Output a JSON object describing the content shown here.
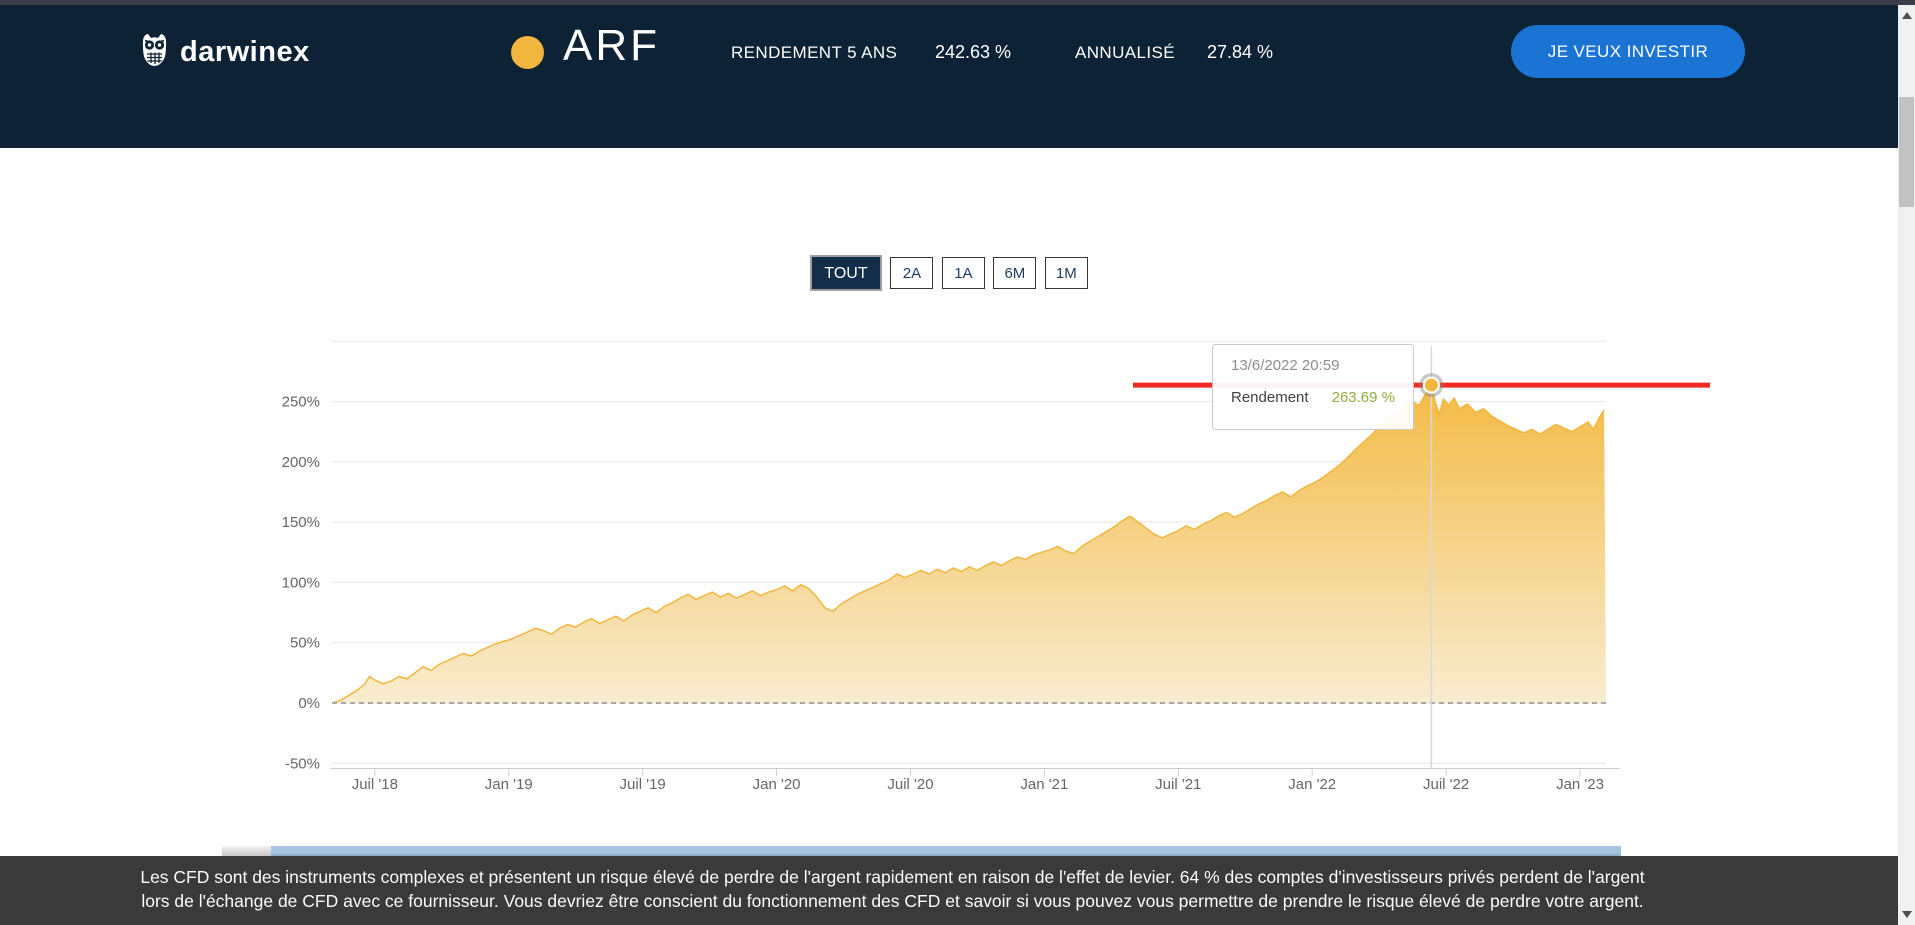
{
  "header": {
    "brand": "darwinex",
    "asset_symbol": "ARF",
    "asset_dot_color": "#f0b63d",
    "bg_color": "#0d2335",
    "stats": [
      {
        "label": "RENDEMENT 5 ANS",
        "value": "242.63 %"
      },
      {
        "label": "ANNUALISÉ",
        "value": "27.84 %"
      }
    ],
    "cta_label": "JE VEUX INVESTIR",
    "cta_color": "#1b74d3"
  },
  "range_selector": {
    "selected": "TOUT",
    "buttons": [
      "TOUT",
      "2A",
      "1A",
      "6M",
      "1M"
    ]
  },
  "chart_data": {
    "type": "area",
    "title": "",
    "series": [
      {
        "name": "Rendement",
        "color": "#f0b63d",
        "fill_top": "#f3bb45",
        "fill_bottom": "#f8ecd0",
        "points": [
          [
            2018.34,
            0
          ],
          [
            2018.37,
            2
          ],
          [
            2018.4,
            6
          ],
          [
            2018.43,
            10
          ],
          [
            2018.46,
            15
          ],
          [
            2018.48,
            22
          ],
          [
            2018.5,
            19
          ],
          [
            2018.53,
            16
          ],
          [
            2018.56,
            18
          ],
          [
            2018.59,
            22
          ],
          [
            2018.62,
            20
          ],
          [
            2018.65,
            25
          ],
          [
            2018.68,
            30
          ],
          [
            2018.71,
            27
          ],
          [
            2018.74,
            32
          ],
          [
            2018.77,
            35
          ],
          [
            2018.8,
            38
          ],
          [
            2018.83,
            41
          ],
          [
            2018.86,
            39
          ],
          [
            2018.89,
            43
          ],
          [
            2018.92,
            46
          ],
          [
            2018.95,
            49
          ],
          [
            2018.98,
            51
          ],
          [
            2019.01,
            53
          ],
          [
            2019.04,
            56
          ],
          [
            2019.07,
            59
          ],
          [
            2019.1,
            62
          ],
          [
            2019.13,
            60
          ],
          [
            2019.16,
            57
          ],
          [
            2019.19,
            62
          ],
          [
            2019.22,
            65
          ],
          [
            2019.25,
            63
          ],
          [
            2019.28,
            67
          ],
          [
            2019.31,
            70
          ],
          [
            2019.34,
            66
          ],
          [
            2019.37,
            69
          ],
          [
            2019.4,
            72
          ],
          [
            2019.43,
            68
          ],
          [
            2019.46,
            73
          ],
          [
            2019.49,
            76
          ],
          [
            2019.52,
            79
          ],
          [
            2019.55,
            75
          ],
          [
            2019.58,
            80
          ],
          [
            2019.61,
            83
          ],
          [
            2019.64,
            87
          ],
          [
            2019.67,
            90
          ],
          [
            2019.7,
            86
          ],
          [
            2019.73,
            89
          ],
          [
            2019.76,
            92
          ],
          [
            2019.79,
            88
          ],
          [
            2019.82,
            91
          ],
          [
            2019.85,
            87
          ],
          [
            2019.88,
            90
          ],
          [
            2019.91,
            93
          ],
          [
            2019.94,
            89
          ],
          [
            2019.97,
            92
          ],
          [
            2020.0,
            94
          ],
          [
            2020.03,
            97
          ],
          [
            2020.06,
            93
          ],
          [
            2020.09,
            98
          ],
          [
            2020.12,
            95
          ],
          [
            2020.15,
            88
          ],
          [
            2020.18,
            79
          ],
          [
            2020.21,
            76
          ],
          [
            2020.24,
            82
          ],
          [
            2020.27,
            86
          ],
          [
            2020.3,
            90
          ],
          [
            2020.33,
            93
          ],
          [
            2020.36,
            96
          ],
          [
            2020.39,
            99
          ],
          [
            2020.42,
            102
          ],
          [
            2020.45,
            107
          ],
          [
            2020.48,
            104
          ],
          [
            2020.51,
            107
          ],
          [
            2020.54,
            110
          ],
          [
            2020.57,
            107
          ],
          [
            2020.6,
            111
          ],
          [
            2020.63,
            108
          ],
          [
            2020.66,
            112
          ],
          [
            2020.69,
            109
          ],
          [
            2020.72,
            113
          ],
          [
            2020.75,
            110
          ],
          [
            2020.78,
            114
          ],
          [
            2020.81,
            117
          ],
          [
            2020.84,
            114
          ],
          [
            2020.87,
            118
          ],
          [
            2020.9,
            121
          ],
          [
            2020.93,
            119
          ],
          [
            2020.96,
            123
          ],
          [
            2020.99,
            125
          ],
          [
            2021.02,
            127
          ],
          [
            2021.05,
            130
          ],
          [
            2021.08,
            126
          ],
          [
            2021.11,
            124
          ],
          [
            2021.14,
            130
          ],
          [
            2021.17,
            134
          ],
          [
            2021.2,
            138
          ],
          [
            2021.23,
            142
          ],
          [
            2021.26,
            146
          ],
          [
            2021.29,
            151
          ],
          [
            2021.32,
            155
          ],
          [
            2021.35,
            150
          ],
          [
            2021.38,
            145
          ],
          [
            2021.41,
            140
          ],
          [
            2021.44,
            137
          ],
          [
            2021.47,
            140
          ],
          [
            2021.5,
            143
          ],
          [
            2021.53,
            147
          ],
          [
            2021.56,
            144
          ],
          [
            2021.59,
            148
          ],
          [
            2021.62,
            151
          ],
          [
            2021.65,
            155
          ],
          [
            2021.68,
            158
          ],
          [
            2021.71,
            154
          ],
          [
            2021.74,
            157
          ],
          [
            2021.77,
            161
          ],
          [
            2021.8,
            165
          ],
          [
            2021.83,
            168
          ],
          [
            2021.86,
            172
          ],
          [
            2021.89,
            175
          ],
          [
            2021.92,
            171
          ],
          [
            2021.95,
            176
          ],
          [
            2021.98,
            180
          ],
          [
            2022.01,
            183
          ],
          [
            2022.04,
            187
          ],
          [
            2022.07,
            192
          ],
          [
            2022.1,
            197
          ],
          [
            2022.13,
            203
          ],
          [
            2022.16,
            210
          ],
          [
            2022.19,
            216
          ],
          [
            2022.22,
            222
          ],
          [
            2022.25,
            229
          ],
          [
            2022.28,
            235
          ],
          [
            2022.31,
            240
          ],
          [
            2022.34,
            245
          ],
          [
            2022.37,
            250
          ],
          [
            2022.4,
            247
          ],
          [
            2022.42,
            255
          ],
          [
            2022.445,
            263.69
          ],
          [
            2022.46,
            249
          ],
          [
            2022.475,
            240
          ],
          [
            2022.49,
            252
          ],
          [
            2022.51,
            247
          ],
          [
            2022.53,
            253
          ],
          [
            2022.55,
            244
          ],
          [
            2022.58,
            248
          ],
          [
            2022.61,
            241
          ],
          [
            2022.64,
            244
          ],
          [
            2022.67,
            238
          ],
          [
            2022.7,
            234
          ],
          [
            2022.73,
            230
          ],
          [
            2022.76,
            227
          ],
          [
            2022.79,
            224
          ],
          [
            2022.82,
            227
          ],
          [
            2022.85,
            223
          ],
          [
            2022.88,
            227
          ],
          [
            2022.91,
            231
          ],
          [
            2022.94,
            228
          ],
          [
            2022.97,
            225
          ],
          [
            2023.0,
            229
          ],
          [
            2023.03,
            233
          ],
          [
            2023.05,
            227
          ],
          [
            2023.07,
            236
          ],
          [
            2023.09,
            243
          ]
        ]
      }
    ],
    "x_range": [
      2018.34,
      2023.097
    ],
    "ylim": [
      -50,
      300
    ],
    "threshold": 0,
    "grid": "horizontal",
    "legend": false,
    "x_ticks": [
      {
        "t": 2018.5,
        "label": "Juil '18"
      },
      {
        "t": 2019.0,
        "label": "Jan '19"
      },
      {
        "t": 2019.5,
        "label": "Juil '19"
      },
      {
        "t": 2020.0,
        "label": "Jan '20"
      },
      {
        "t": 2020.5,
        "label": "Juil '20"
      },
      {
        "t": 2021.0,
        "label": "Jan '21"
      },
      {
        "t": 2021.5,
        "label": "Juil '21"
      },
      {
        "t": 2022.0,
        "label": "Jan '22"
      },
      {
        "t": 2022.5,
        "label": "Juil '22"
      },
      {
        "t": 2023.0,
        "label": "Jan '23"
      }
    ],
    "y_ticks": [
      {
        "v": -50,
        "label": "-50%"
      },
      {
        "v": 0,
        "label": "0%"
      },
      {
        "v": 50,
        "label": "50%"
      },
      {
        "v": 100,
        "label": "100%"
      },
      {
        "v": 150,
        "label": "150%"
      },
      {
        "v": 200,
        "label": "200%"
      },
      {
        "v": 250,
        "label": "250%"
      },
      {
        "v": 300,
        "label": ""
      }
    ],
    "marker": {
      "t": 2022.445,
      "v": 263.69
    },
    "crosshair_t": 2022.445,
    "red_line": {
      "value": 263.69,
      "color": "#ee2a22"
    }
  },
  "tooltip": {
    "datetime": "13/6/2022 20:59",
    "series_label": "Rendement",
    "value": "263.69 %",
    "value_color": "#94ad40"
  },
  "disclaimer": {
    "line1": "Les CFD sont des instruments complexes et présentent un risque élevé de perdre de l'argent rapidement en raison de l'effet de levier. 64 % des comptes d'investisseurs privés perdent de l'argent",
    "line2": "lors de l'échange de CFD avec ce fournisseur. Vous devriez être conscient du fonctionnement des CFD et savoir si vous pouvez vous permettre de prendre le risque élevé de perdre votre argent."
  }
}
